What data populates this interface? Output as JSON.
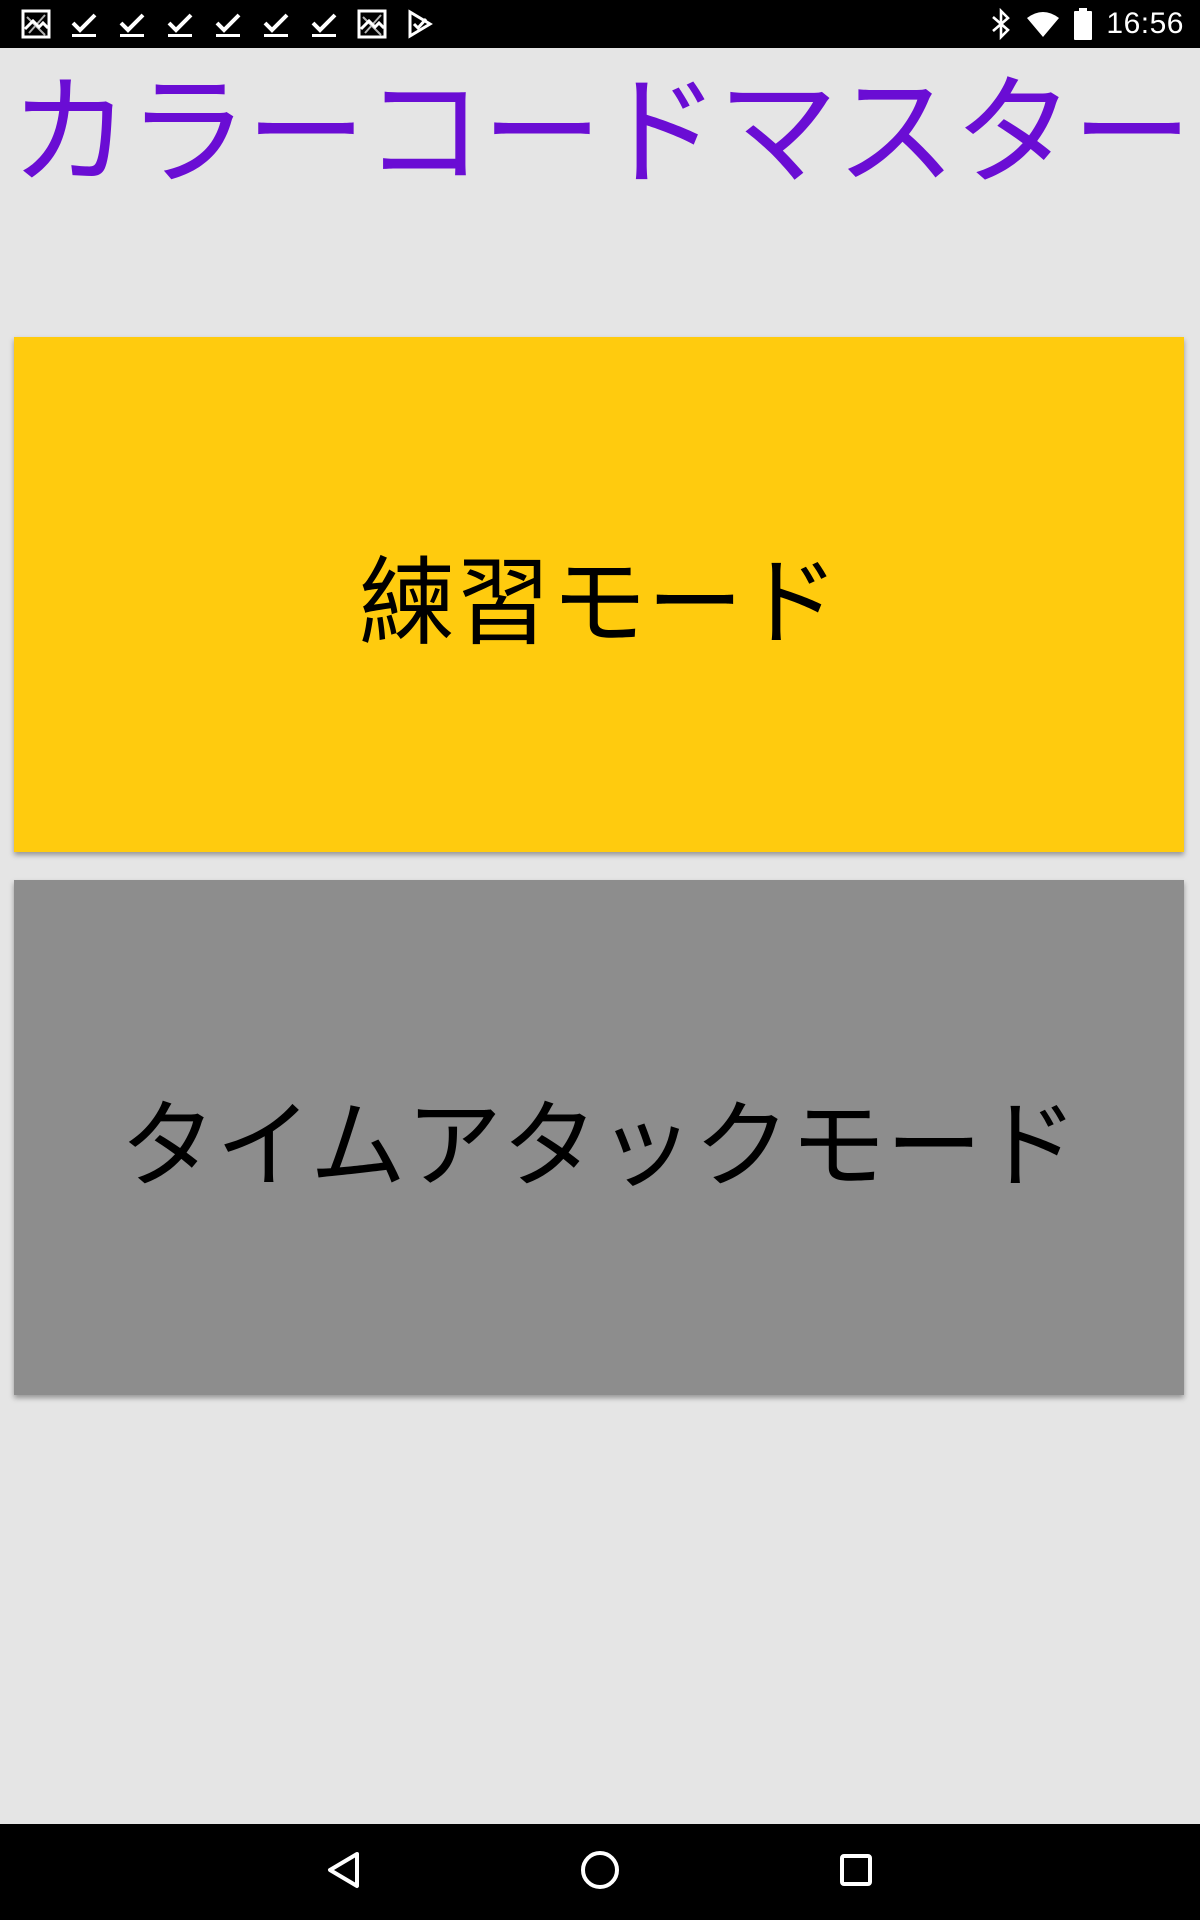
{
  "status_bar": {
    "time": "16:56",
    "left_icons": [
      "photo-icon",
      "download-done-icon",
      "download-done-icon",
      "download-done-icon",
      "download-done-icon",
      "download-done-icon",
      "download-done-icon",
      "photo-icon",
      "play-store-icon"
    ],
    "right_icons": [
      "bluetooth-icon",
      "wifi-icon",
      "battery-icon"
    ]
  },
  "app": {
    "title": "カラーコードマスター",
    "title_color": "#6a0dd4"
  },
  "buttons": {
    "practice": {
      "label": "練習モード",
      "color": "#ffcb0e"
    },
    "time_attack": {
      "label": "タイムアタックモード",
      "color": "#8d8d8d"
    }
  },
  "nav_bar": {
    "buttons": [
      "back-icon",
      "home-icon",
      "recents-icon"
    ]
  }
}
